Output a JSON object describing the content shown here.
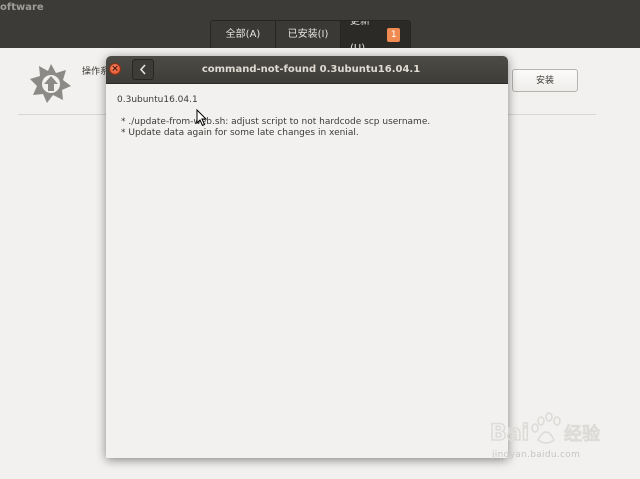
{
  "app": {
    "title": "oftware",
    "tabs": [
      {
        "label": "全部(A)"
      },
      {
        "label": "已安装(I)"
      },
      {
        "label": "更新(U)",
        "badge": "1",
        "active": true
      }
    ],
    "updates": {
      "item_name": "操作系",
      "install_label": "安装"
    }
  },
  "dialog": {
    "title": "command-not-found 0.3ubuntu16.04.1",
    "version": "0.3ubuntu16.04.1",
    "changelog": [
      "* ./update-from-web.sh: adjust script to not hardcode scp username.",
      "* Update data again for some late changes in xenial."
    ],
    "close_icon": "close-icon",
    "back_icon": "chevron-left-icon"
  },
  "watermark": {
    "logo_text": "Bai 经验",
    "url": "jingyan.baidu.com"
  },
  "colors": {
    "header_bg": "#3c3b37",
    "badge": "#f08b52",
    "close": "#dc4b22",
    "dialog_bg": "#f2f1f0"
  }
}
